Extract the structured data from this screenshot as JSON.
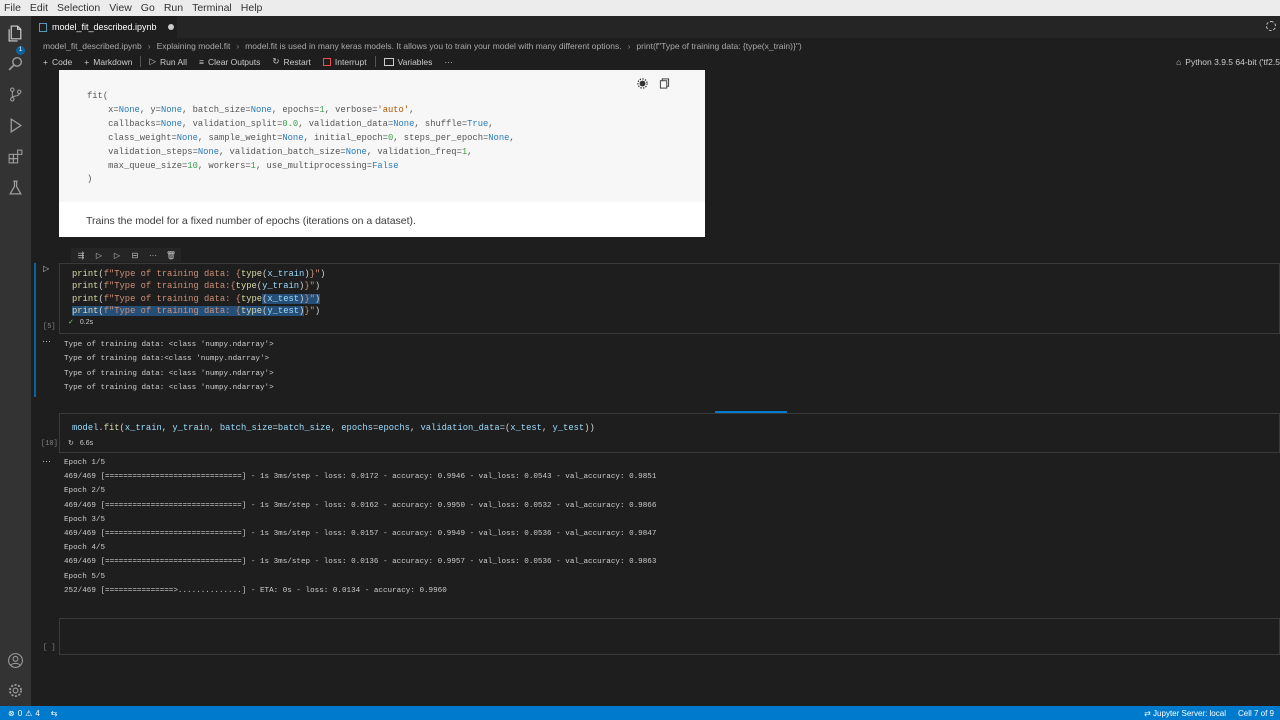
{
  "menu": [
    "File",
    "Edit",
    "Selection",
    "View",
    "Go",
    "Run",
    "Terminal",
    "Help"
  ],
  "tab": {
    "name": "model_fit_described.ipynb"
  },
  "breadcrumb": {
    "file": "model_fit_described.ipynb",
    "section": "Explaining model.fit",
    "subsection": "model.fit is used in many keras models. It allows you to train your model with many different options.",
    "cell": "print(f\"Type of training data: {type(x_train)}\")"
  },
  "toolbar": {
    "code": "Code",
    "markdown": "Markdown",
    "run_all": "Run All",
    "clear_outputs": "Clear Outputs",
    "restart": "Restart",
    "interrupt": "Interrupt",
    "variables": "Variables",
    "more": "···",
    "kernel": "Python 3.9.5 64-bit ('tf2.5"
  },
  "doc": {
    "lines": [
      "fit(",
      "    x=None, y=None, batch_size=None, epochs=1, verbose='auto',",
      "    callbacks=None, validation_split=0.0, validation_data=None, shuffle=True,",
      "    class_weight=None, sample_weight=None, initial_epoch=0, steps_per_epoch=None,",
      "    validation_steps=None, validation_batch_size=None, validation_freq=1,",
      "    max_queue_size=10, workers=1, use_multiprocessing=False",
      ")"
    ],
    "description": "Trains the model for a fixed number of epochs (iterations on a dataset)."
  },
  "cell1": {
    "exec_count": "[5]",
    "time": "0.2s",
    "code": [
      "print(f\"Type of training data: {type(x_train)}\")",
      "print(f\"Type of training data:{type(y_train)}\")",
      "print(f\"Type of training data: {type(x_test)}\")",
      "print(f\"Type of training data: {type(y_test)}\")"
    ],
    "output": [
      "Type of training data: <class 'numpy.ndarray'>",
      "Type of training data:<class 'numpy.ndarray'>",
      "Type of training data: <class 'numpy.ndarray'>",
      "Type of training data: <class 'numpy.ndarray'>"
    ]
  },
  "cell2": {
    "exec_count": "[10]",
    "time": "6.6s",
    "code": "model.fit(x_train, y_train, batch_size=batch_size, epochs=epochs, validation_data=(x_test, y_test))",
    "output": [
      "Epoch 1/5",
      "469/469 [==============================] - 1s 3ms/step - loss: 0.0172 - accuracy: 0.9946 - val_loss: 0.0543 - val_accuracy: 0.9851",
      "Epoch 2/5",
      "469/469 [==============================] - 1s 3ms/step - loss: 0.0162 - accuracy: 0.9950 - val_loss: 0.0532 - val_accuracy: 0.9866",
      "Epoch 3/5",
      "469/469 [==============================] - 1s 3ms/step - loss: 0.0157 - accuracy: 0.9949 - val_loss: 0.0536 - val_accuracy: 0.9847",
      "Epoch 4/5",
      "469/469 [==============================] - 1s 3ms/step - loss: 0.0136 - accuracy: 0.9957 - val_loss: 0.0536 - val_accuracy: 0.9863",
      "Epoch 5/5",
      "252/469 [===============>..............] - ETA: 0s - loss: 0.0134 - accuracy: 0.9960"
    ]
  },
  "cell3": {
    "exec_count": "[ ]"
  },
  "status": {
    "errors": "0",
    "warnings": "4",
    "server": "Jupyter Server: local",
    "cell": "Cell 7 of 9"
  },
  "colors": {
    "accent": "#007acc",
    "activity": "#333333",
    "editor": "#1e1e1e"
  }
}
